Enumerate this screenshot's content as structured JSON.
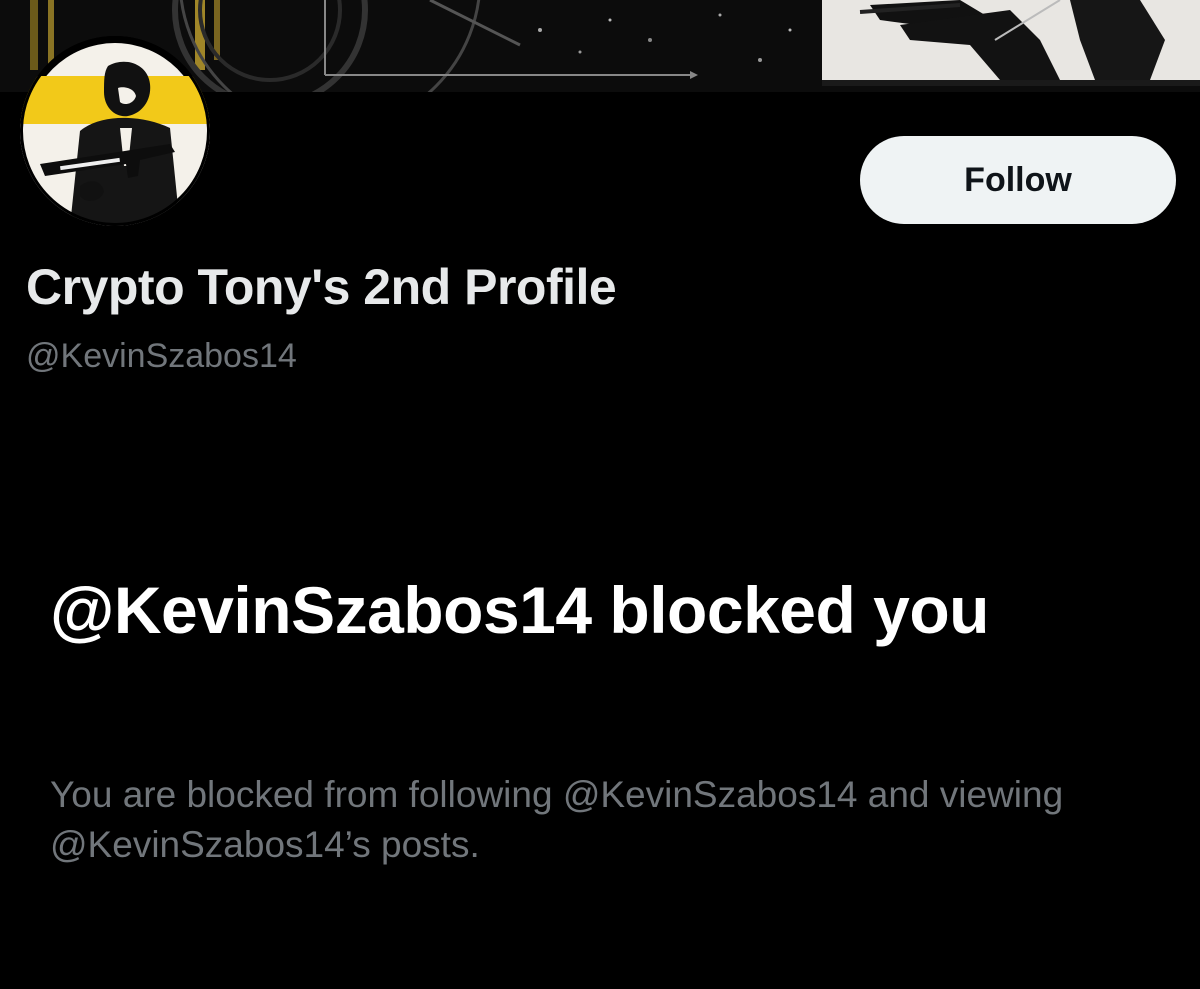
{
  "profile": {
    "display_name": "Crypto Tony's 2nd Profile",
    "handle": "@KevinSzabos14",
    "avatar_icon": "profile-avatar-image",
    "banner_icon": "profile-banner-image"
  },
  "actions": {
    "follow_label": "Follow"
  },
  "blocked_notice": {
    "heading": "@KevinSzabos14 blocked you",
    "description": "You are blocked from following @KevinSzabos14 and viewing @KevinSzabos14’s posts."
  },
  "colors": {
    "background": "#000000",
    "primary_text": "#e7e9ea",
    "secondary_text": "#71767b",
    "button_bg": "#eff3f4",
    "button_text": "#0f1419",
    "avatar_accent": "#f2c919"
  }
}
